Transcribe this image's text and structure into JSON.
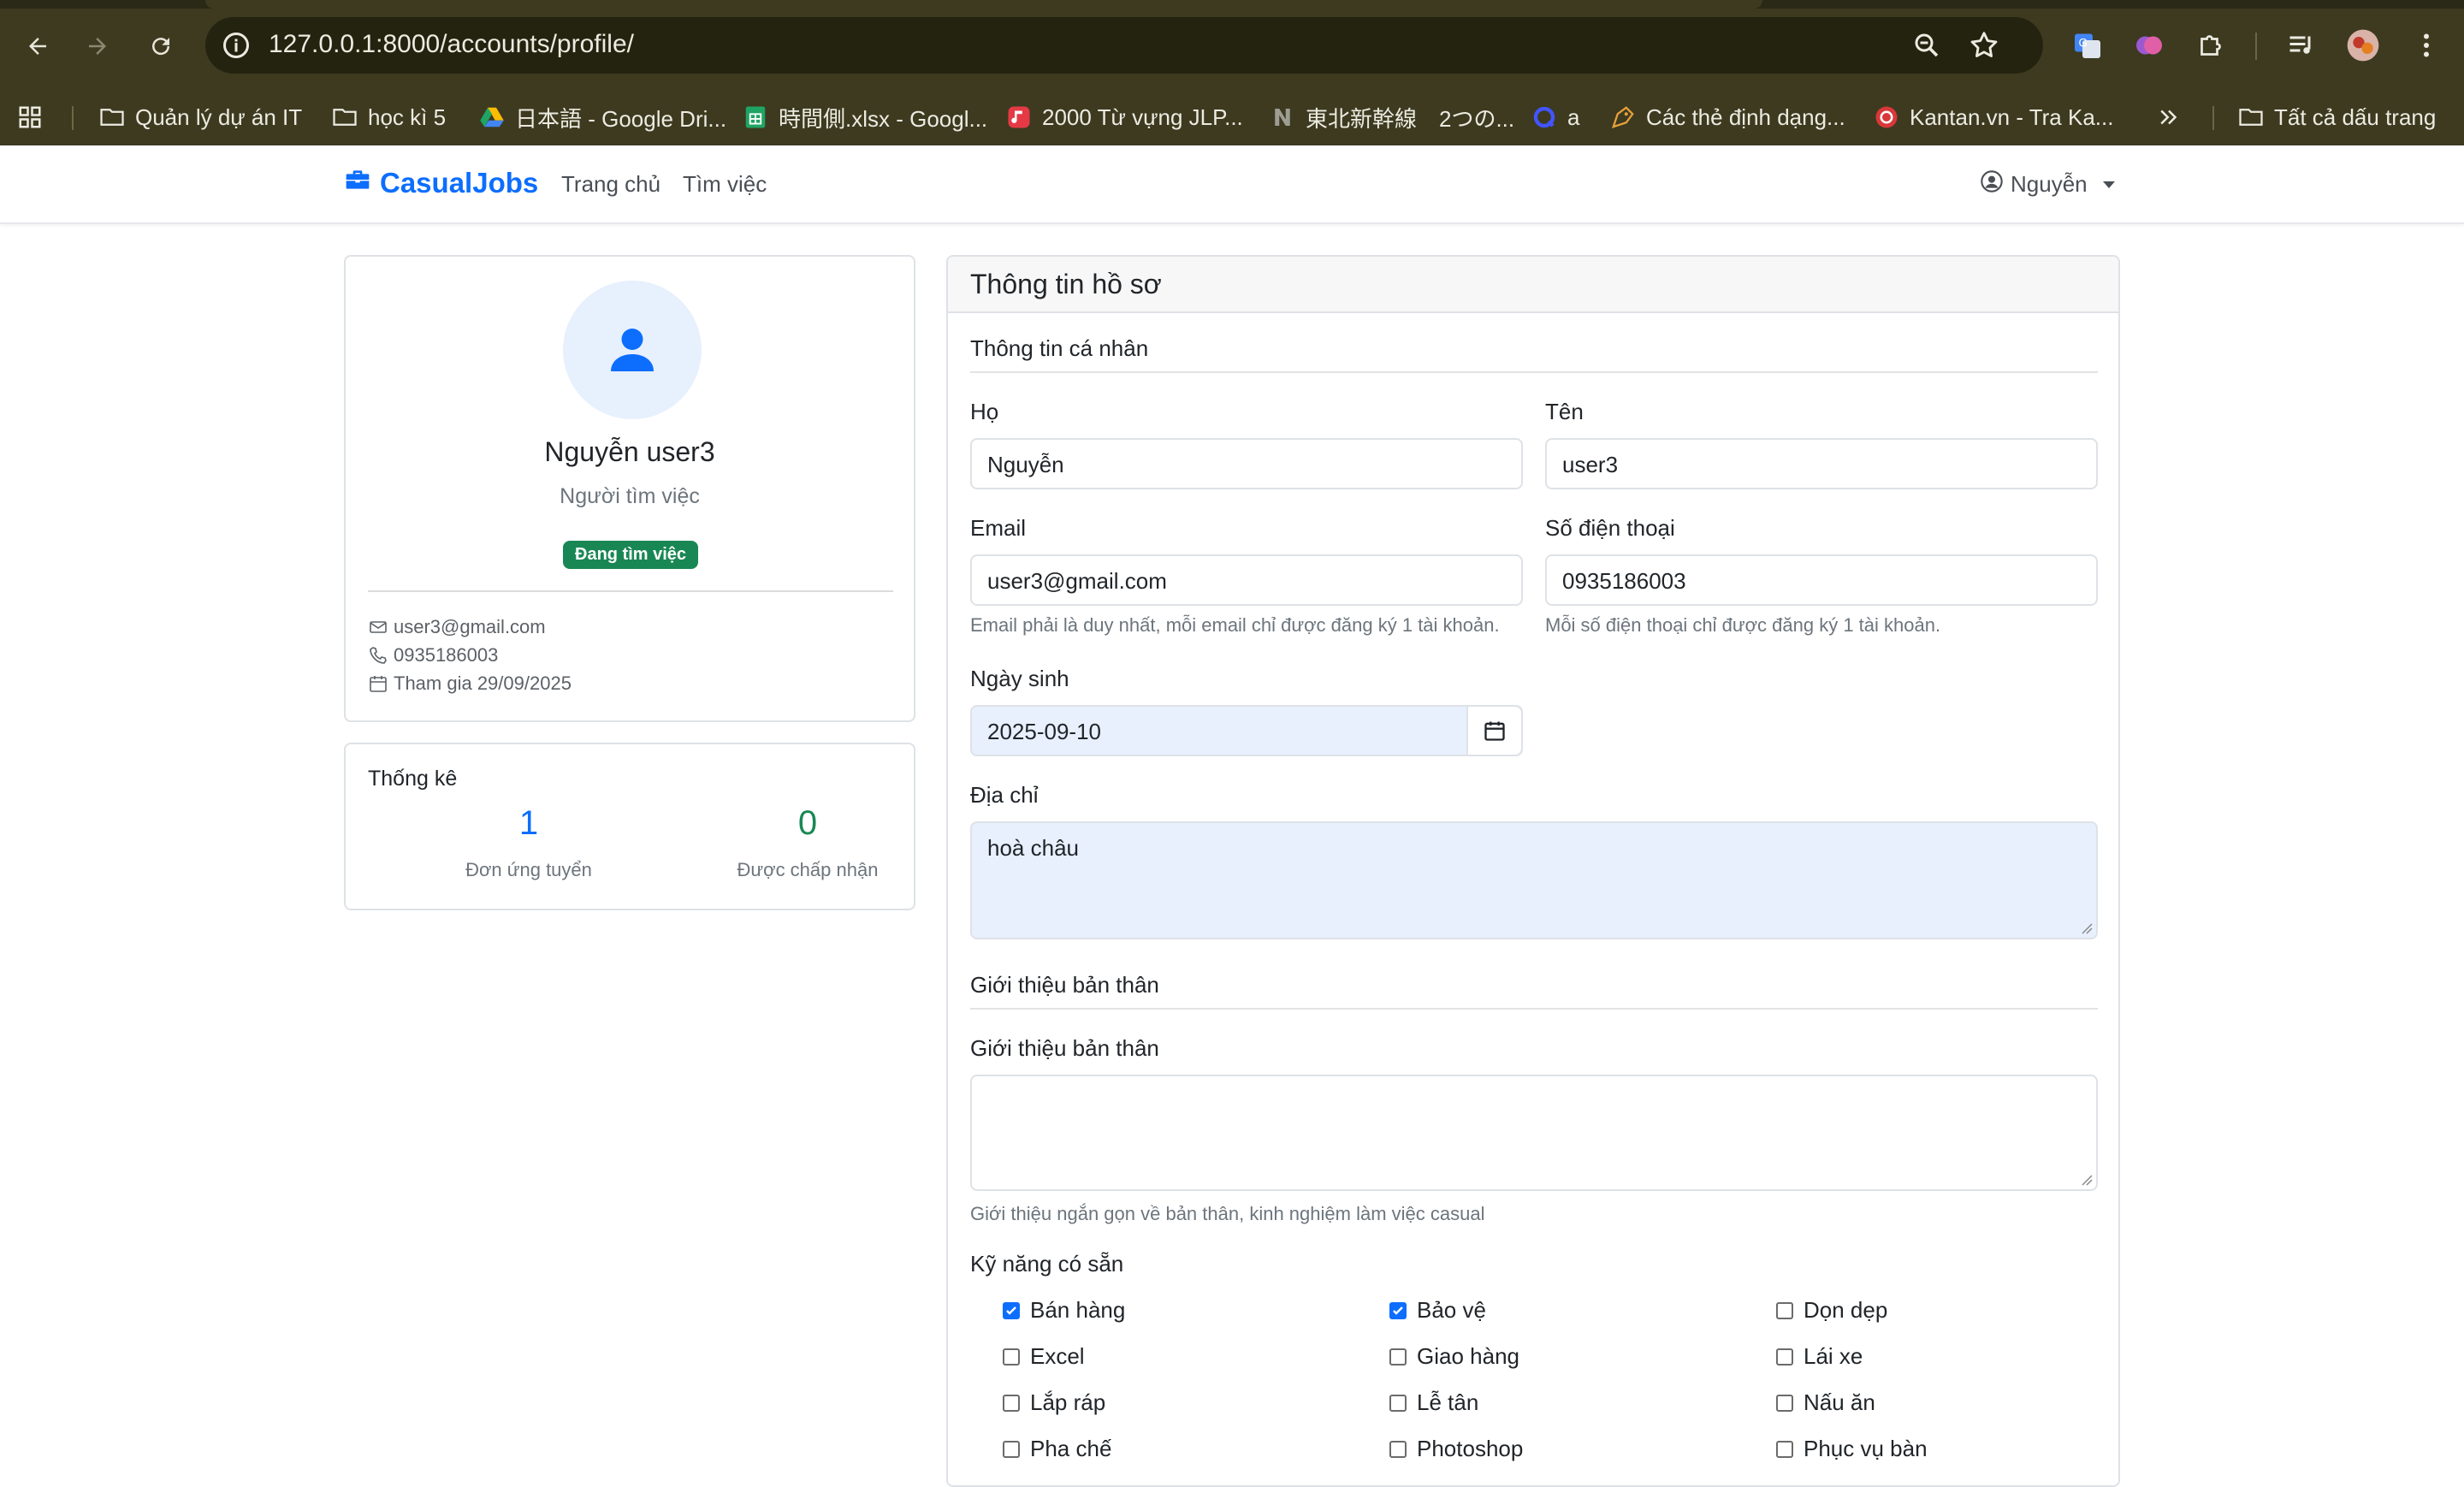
{
  "browser": {
    "url": "127.0.0.1:8000/accounts/profile/",
    "bookmarks": [
      {
        "label": "Quản lý dự án IT",
        "icon": "folder-icon"
      },
      {
        "label": "học kì 5",
        "icon": "folder-icon"
      },
      {
        "label": "日本語 - Google Dri...",
        "icon": "google-drive-icon"
      },
      {
        "label": "時間側.xlsx - Googl...",
        "icon": "google-sheets-icon"
      },
      {
        "label": "2000 Từ vựng JLP...",
        "icon": "music-app-icon"
      },
      {
        "label": "東北新幹線　2つの...",
        "icon": "notion-icon"
      },
      {
        "label": "a",
        "icon": "quizlet-icon"
      },
      {
        "label": "Các thẻ định dạng...",
        "icon": "tag-icon"
      },
      {
        "label": "Kantan.vn - Tra Ka...",
        "icon": "kantan-icon"
      },
      {
        "label": "Tất cả dấu trang",
        "icon": "folder-icon"
      }
    ]
  },
  "navbar": {
    "brand": "CasualJobs",
    "links": [
      "Trang chủ",
      "Tìm việc"
    ],
    "user": "Nguyễn"
  },
  "profile": {
    "name": "Nguyễn user3",
    "role": "Người tìm việc",
    "badge": "Đang tìm việc",
    "email": "user3@gmail.com",
    "phone": "0935186003",
    "joined": "Tham gia 29/09/2025"
  },
  "stats": {
    "title": "Thống kê",
    "applications_count": "1",
    "applications_label": "Đơn ứng tuyển",
    "accepted_count": "0",
    "accepted_label": "Được chấp nhận"
  },
  "form": {
    "header": "Thông tin hồ sơ",
    "personal_section": "Thông tin cá nhân",
    "last_name_label": "Họ",
    "last_name_value": "Nguyễn",
    "first_name_label": "Tên",
    "first_name_value": "user3",
    "email_label": "Email",
    "email_value": "user3@gmail.com",
    "email_help": "Email phải là duy nhất, mỗi email chỉ được đăng ký 1 tài khoản.",
    "phone_label": "Số điện thoại",
    "phone_value": "0935186003",
    "phone_help": "Mỗi số điện thoại chỉ được đăng ký 1 tài khoản.",
    "dob_label": "Ngày sinh",
    "dob_value": "2025-09-10",
    "address_label": "Địa chỉ",
    "address_value": "hoà châu",
    "bio_section": "Giới thiệu bản thân",
    "bio_label": "Giới thiệu bản thân",
    "bio_value": "",
    "bio_help": "Giới thiệu ngắn gọn về bản thân, kinh nghiệm làm việc casual",
    "skills_label": "Kỹ năng có sẵn",
    "skills": [
      {
        "label": "Bán hàng",
        "checked": true
      },
      {
        "label": "Bảo vệ",
        "checked": true
      },
      {
        "label": "Dọn dẹp",
        "checked": false
      },
      {
        "label": "Excel",
        "checked": false
      },
      {
        "label": "Giao hàng",
        "checked": false
      },
      {
        "label": "Lái xe",
        "checked": false
      },
      {
        "label": "Lắp ráp",
        "checked": false
      },
      {
        "label": "Lễ tân",
        "checked": false
      },
      {
        "label": "Nấu ăn",
        "checked": false
      },
      {
        "label": "Pha chế",
        "checked": false
      },
      {
        "label": "Photoshop",
        "checked": false
      },
      {
        "label": "Phục vụ bàn",
        "checked": false
      }
    ]
  },
  "colors": {
    "primary": "#0d6efd",
    "success": "#198754",
    "chrome": "#3d3a20"
  }
}
